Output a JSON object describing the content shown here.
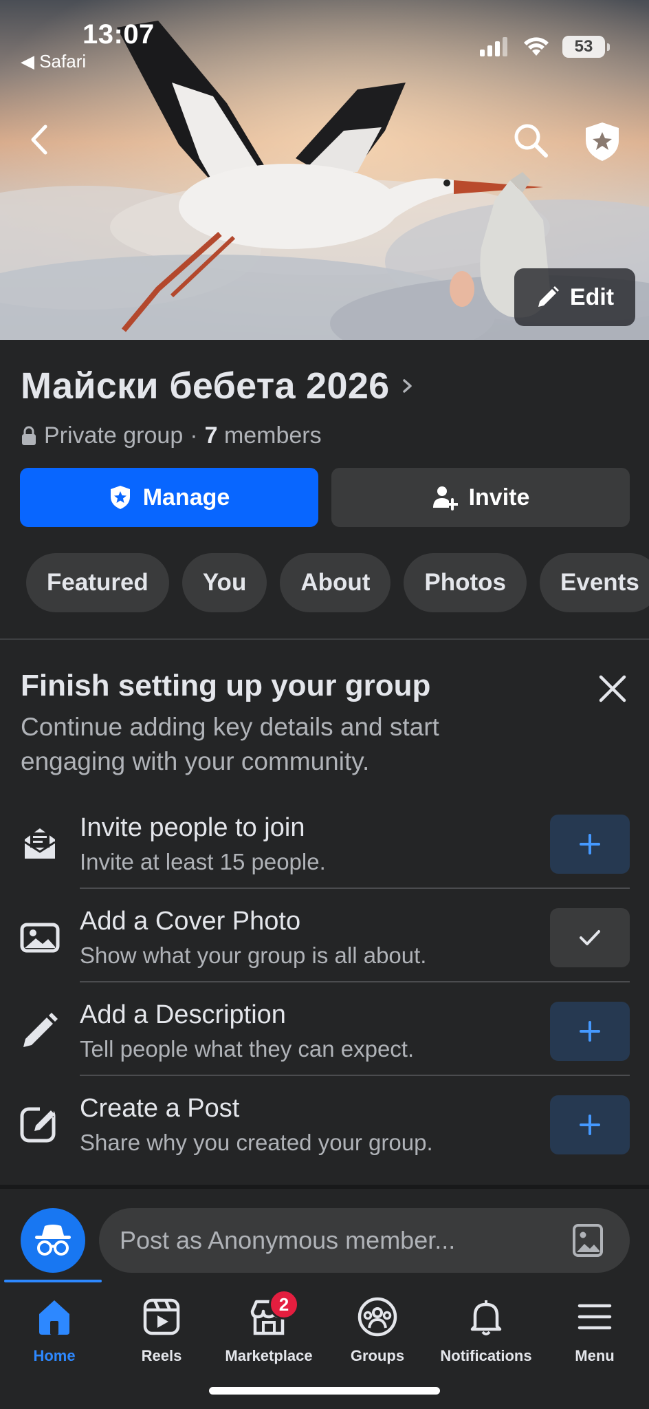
{
  "status_bar": {
    "time": "13:07",
    "back_app": "◀ Safari",
    "battery": "53"
  },
  "cover": {
    "edit_label": "Edit"
  },
  "group": {
    "name": "Майски бебета 2026",
    "privacy": "Private group",
    "separator": "·",
    "member_count": "7",
    "members_label": "members"
  },
  "actions": {
    "manage_label": "Manage",
    "invite_label": "Invite"
  },
  "tabs": [
    "Featured",
    "You",
    "About",
    "Photos",
    "Events"
  ],
  "setup": {
    "title": "Finish setting up your group",
    "description": "Continue adding key details and start engaging with your community.",
    "tasks": [
      {
        "title": "Invite people to join",
        "subtitle": "Invite at least 15 people.",
        "icon": "envelope-icon",
        "status": "add"
      },
      {
        "title": "Add a Cover Photo",
        "subtitle": "Show what your group is all about.",
        "icon": "image-icon",
        "status": "done"
      },
      {
        "title": "Add a Description",
        "subtitle": "Tell people what they can expect.",
        "icon": "pencil-icon",
        "status": "add"
      },
      {
        "title": "Create a Post",
        "subtitle": "Share why you created your group.",
        "icon": "compose-icon",
        "status": "add"
      }
    ]
  },
  "composer": {
    "placeholder": "Post as Anonymous member..."
  },
  "nav": {
    "items": [
      {
        "label": "Home",
        "icon": "home-icon",
        "active": true
      },
      {
        "label": "Reels",
        "icon": "reels-icon"
      },
      {
        "label": "Marketplace",
        "icon": "marketplace-icon",
        "badge": "2"
      },
      {
        "label": "Groups",
        "icon": "groups-icon"
      },
      {
        "label": "Notifications",
        "icon": "bell-icon"
      },
      {
        "label": "Menu",
        "icon": "menu-icon"
      }
    ]
  },
  "colors": {
    "accent": "#0866ff",
    "background": "#242526",
    "chip": "#3a3b3c",
    "badge": "#e41e3f"
  }
}
